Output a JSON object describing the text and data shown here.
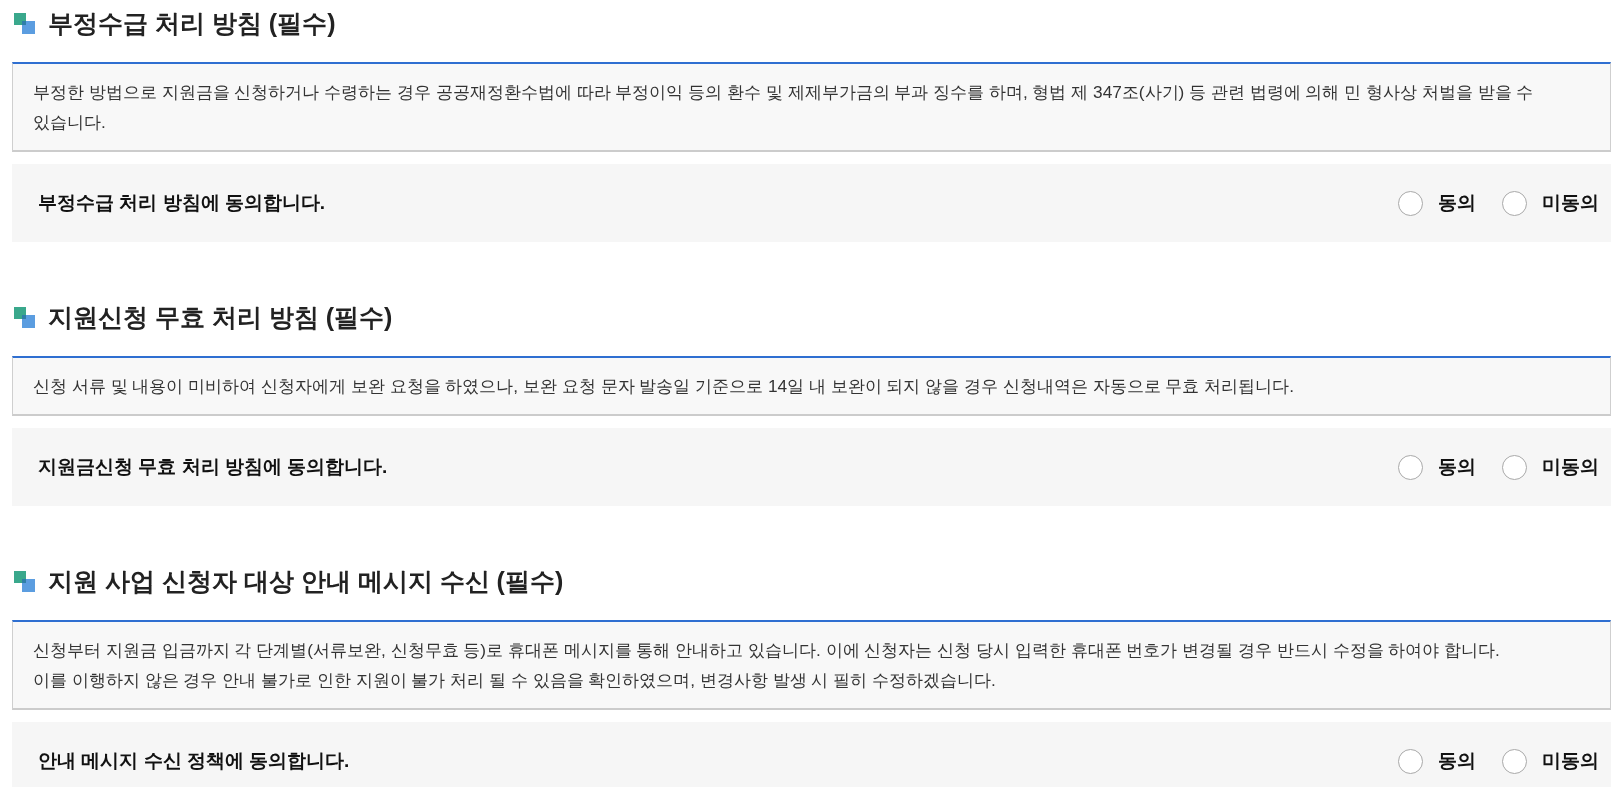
{
  "sections": [
    {
      "title": "부정수급 처리 방침 (필수)",
      "body": [
        "부정한 방법으로 지원금을 신청하거나 수령하는 경우 공공재정환수법에 따라 부정이익 등의 환수 및 제제부가금의 부과 징수를 하며, 형법 제 347조(사기) 등 관련 법령에 의해 민 형사상 처벌을 받을 수 있습니다."
      ],
      "agreement": {
        "label": "부정수급 처리 방침에 동의합니다.",
        "options": [
          {
            "label": "동의",
            "selected": false
          },
          {
            "label": "미동의",
            "selected": false
          }
        ]
      }
    },
    {
      "title": "지원신청 무효 처리 방침 (필수)",
      "body": [
        "신청 서류 및 내용이 미비하여 신청자에게 보완 요청을 하였으나, 보완 요청 문자 발송일 기준으로 14일 내 보완이 되지 않을 경우 신청내역은 자동으로 무효 처리됩니다."
      ],
      "agreement": {
        "label": "지원금신청 무효 처리 방침에 동의합니다.",
        "options": [
          {
            "label": "동의",
            "selected": false
          },
          {
            "label": "미동의",
            "selected": false
          }
        ]
      }
    },
    {
      "title": "지원 사업 신청자 대상 안내 메시지 수신 (필수)",
      "body": [
        "신청부터 지원금 입금까지 각 단계별(서류보완, 신청무효 등)로 휴대폰 메시지를 통해 안내하고 있습니다. 이에 신청자는 신청 당시 입력한 휴대폰 번호가 변경될 경우 반드시 수정을 하여야 합니다.",
        "이를 이행하지 않은 경우 안내 불가로 인한 지원이 불가 처리 될 수 있음을 확인하였으며, 변경사항 발생 시 필히 수정하겠습니다."
      ],
      "agreement": {
        "label": "안내 메시지 수신 정책에 동의합니다.",
        "options": [
          {
            "label": "동의",
            "selected": false
          },
          {
            "label": "미동의",
            "selected": false
          }
        ]
      }
    }
  ]
}
